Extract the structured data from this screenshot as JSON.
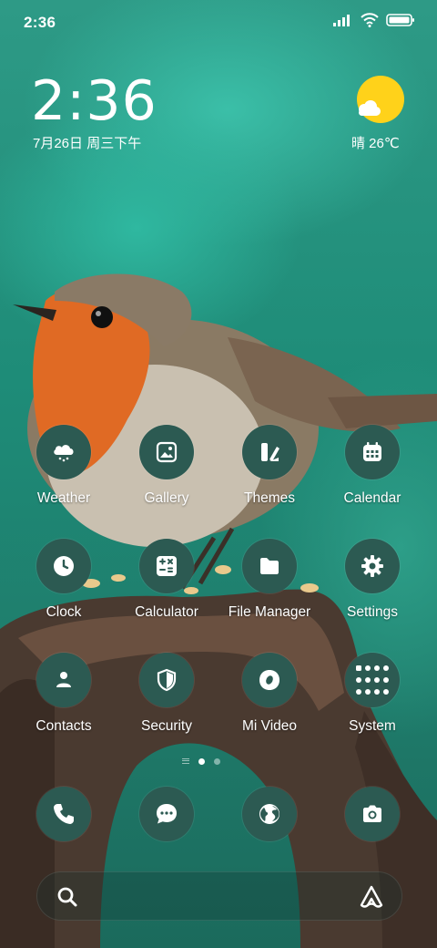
{
  "status_bar": {
    "time": "2:36",
    "icons": [
      "signal-icon",
      "wifi-icon",
      "battery-icon"
    ]
  },
  "clock_widget": {
    "time": "2:36",
    "date": "7月26日 周三下午"
  },
  "weather_widget": {
    "text": "晴 26℃",
    "icon": "sun-cloud-icon"
  },
  "apps": [
    {
      "label": "Weather",
      "icon": "weather-icon"
    },
    {
      "label": "Gallery",
      "icon": "gallery-icon"
    },
    {
      "label": "Themes",
      "icon": "themes-icon"
    },
    {
      "label": "Calendar",
      "icon": "calendar-icon"
    },
    {
      "label": "Clock",
      "icon": "clock-icon"
    },
    {
      "label": "Calculator",
      "icon": "calculator-icon"
    },
    {
      "label": "File Manager",
      "icon": "folder-icon"
    },
    {
      "label": "Settings",
      "icon": "gear-icon"
    },
    {
      "label": "Contacts",
      "icon": "contacts-icon"
    },
    {
      "label": "Security",
      "icon": "shield-icon"
    },
    {
      "label": "Mi Video",
      "icon": "video-icon"
    },
    {
      "label": "System",
      "icon": "folder-grid-icon"
    }
  ],
  "page_indicator": {
    "pages": 2,
    "current": 1
  },
  "dock": [
    {
      "icon": "phone-icon"
    },
    {
      "icon": "messages-icon"
    },
    {
      "icon": "browser-icon"
    },
    {
      "icon": "camera-icon"
    }
  ],
  "search_bar": {
    "icons": [
      "search-icon",
      "assistant-icon"
    ]
  },
  "colors": {
    "icon_background": "#2c5a52",
    "wallpaper_teal": "#2e9a86",
    "sun": "#ffd21a"
  }
}
